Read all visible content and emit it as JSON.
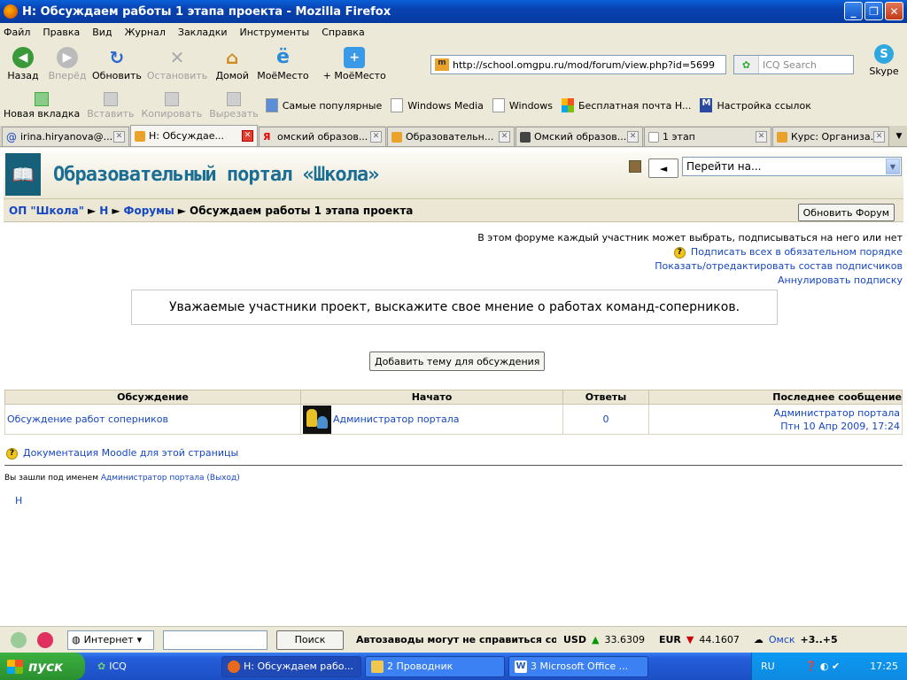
{
  "window": {
    "title": "Н: Обсуждаем работы 1 этапа проекта - Mozilla Firefox"
  },
  "menu": [
    "Файл",
    "Правка",
    "Вид",
    "Журнал",
    "Закладки",
    "Инструменты",
    "Справка"
  ],
  "nav": {
    "back": "Назад",
    "forward": "Вперёд",
    "reload": "Обновить",
    "stop": "Остановить",
    "home": "Домой",
    "mymesto": "МоёМесто",
    "add_mymesto": "+ МоёМесто"
  },
  "url": "http://school.omgpu.ru/mod/forum/view.php?id=5699",
  "search": {
    "placeholder": "ICQ Search"
  },
  "skype": "Skype",
  "bookmarks_toolbar": {
    "new_tab": "Новая вкладка",
    "paste": "Вставить",
    "copy": "Копировать",
    "cut": "Вырезать",
    "links": [
      "Самые популярные",
      "Windows Media",
      "Windows",
      "Бесплатная почта H...",
      "Настройка ссылок"
    ]
  },
  "tabs": [
    "irina.hiryanova@...",
    "Н: Обсуждае...",
    "омский образов...",
    "Образовательн...",
    "Омский образов...",
    "1 этап",
    "Курс: Организа..."
  ],
  "page": {
    "site_name": "Образовательный портал «Школа»",
    "jump_label": "Перейти на...",
    "back_label": "◄",
    "breadcrumb": {
      "root": "ОП \"Школа\"",
      "course": "Н",
      "forums": "Форумы",
      "current": "Обсуждаем работы 1 этапа проекта"
    },
    "update_button": "Обновить Форум",
    "subscription_info": "В этом форуме каждый участник может выбрать, подписываться на него или нет",
    "force_subscribe": "Подписать всех в обязательном порядке",
    "show_subscribers": "Показать/отредактировать состав подписчиков",
    "unsubscribe": "Аннулировать подписку",
    "intro": "Уважаемые участники проект, выскажите свое мнение о работах команд-соперников.",
    "add_topic_button": "Добавить тему для обсуждения",
    "table": {
      "headers": [
        "Обсуждение",
        "Начато",
        "Ответы",
        "Последнее сообщение"
      ],
      "rows": [
        {
          "topic": "Обсуждение работ соперников",
          "author": "Администратор портала",
          "replies": "0",
          "last_author": "Администратор портала",
          "last_date": "Птн 10 Апр 2009, 17:24"
        }
      ]
    },
    "docs_link": "Документация Moodle для этой страницы",
    "login_prefix": "Вы зашли под именем",
    "login_user": "Администратор портала",
    "logout": "(Выход)",
    "footer_link": "Н"
  },
  "statusbar": {
    "zone": "Интернет",
    "search_button": "Поиск",
    "news": "Автозаводы могут не справиться со...",
    "usd_label": "USD",
    "usd_value": "33.6309",
    "eur_label": "EUR",
    "eur_value": "44.1607",
    "city": "Омск",
    "temp": "+3..+5"
  },
  "taskbar": {
    "start": "пуск",
    "quick_app": "ICQ",
    "tasks": [
      "Н: Обсуждаем рабо...",
      "2 Проводник",
      "3 Microsoft Office ..."
    ],
    "lang": "RU",
    "time": "17:25"
  }
}
